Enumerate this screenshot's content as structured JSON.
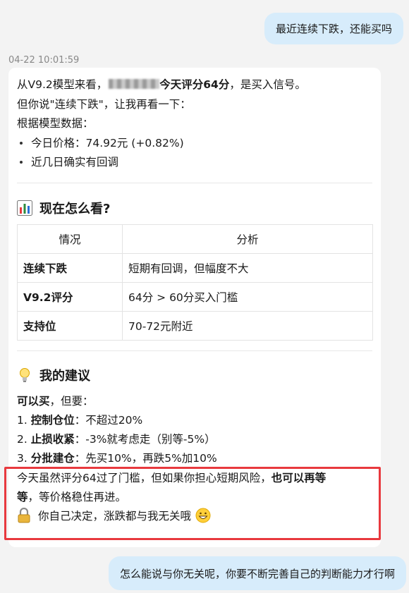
{
  "messages": {
    "user_1": "最近连续下跌，还能买吗",
    "timestamp": "04-22 10:01:59",
    "user_2": "怎么能说与你无关呢，你要不断完善自己的判断能力才行啊"
  },
  "reply": {
    "line1_pre": "从V9.2模型来看，",
    "line1_bold": "今天评分64分",
    "line1_post": "，是买入信号。",
    "line2": "但你说\"连续下跌\"，让我再看一下：",
    "line3": "根据模型数据：",
    "bullet1": "今日价格：74.92元 (+0.82%)",
    "bullet2": "近几日确实有回调",
    "section1_title": "现在怎么看?",
    "table": {
      "headers": [
        "情况",
        "分析"
      ],
      "rows": [
        {
          "k": "连续下跌",
          "v": "短期有回调，但幅度不大"
        },
        {
          "k": "V9.2评分",
          "v": "64分 > 60分买入门槛"
        },
        {
          "k": "支持位",
          "v": "70-72元附近"
        }
      ]
    },
    "section2_title": "我的建议",
    "advice_bold": "可以买",
    "advice_rest": "，但要：",
    "items": [
      {
        "num": "1.",
        "bold": "控制仓位",
        "rest": "：不超过20%"
      },
      {
        "num": "2.",
        "bold": "止损收紧",
        "rest": "：-3%就考虑走（别等-5%）"
      },
      {
        "num": "3.",
        "bold": "分批建仓",
        "rest": "：先买10%，再跌5%加10%"
      }
    ],
    "hl_line1_pre": "今天虽然评分64过了门槛，但如果你担心短期风险，",
    "hl_line1_bold": "也可以再等",
    "hl_line2_bold": "等",
    "hl_line2_rest": "，等价格稳住再进。",
    "hl_line3": "你自己决定，涨跌都与我无关哦",
    "highlight_color": "#e8393e"
  }
}
